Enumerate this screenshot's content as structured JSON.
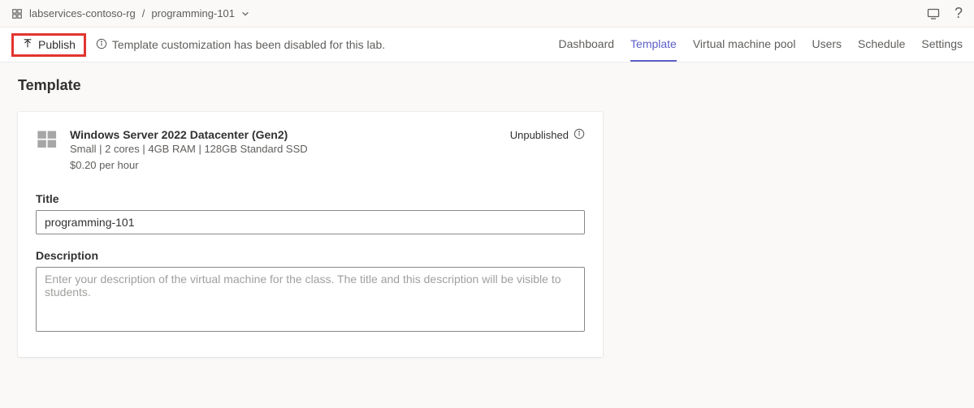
{
  "breadcrumb": {
    "root": "labservices-contoso-rg",
    "separator": "/",
    "current": "programming-101"
  },
  "toolbar": {
    "publish_label": "Publish",
    "info_message": "Template customization has been disabled for this lab."
  },
  "tabs": {
    "dashboard": "Dashboard",
    "template": "Template",
    "vmpool": "Virtual machine pool",
    "users": "Users",
    "schedule": "Schedule",
    "settings": "Settings"
  },
  "page": {
    "title": "Template"
  },
  "vm": {
    "name": "Windows Server 2022 Datacenter (Gen2)",
    "specs": "Small | 2 cores | 4GB RAM | 128GB Standard SSD",
    "price": "$0.20 per hour",
    "status": "Unpublished"
  },
  "form": {
    "title_label": "Title",
    "title_value": "programming-101",
    "description_label": "Description",
    "description_placeholder": "Enter your description of the virtual machine for the class. The title and this description will be visible to students."
  }
}
